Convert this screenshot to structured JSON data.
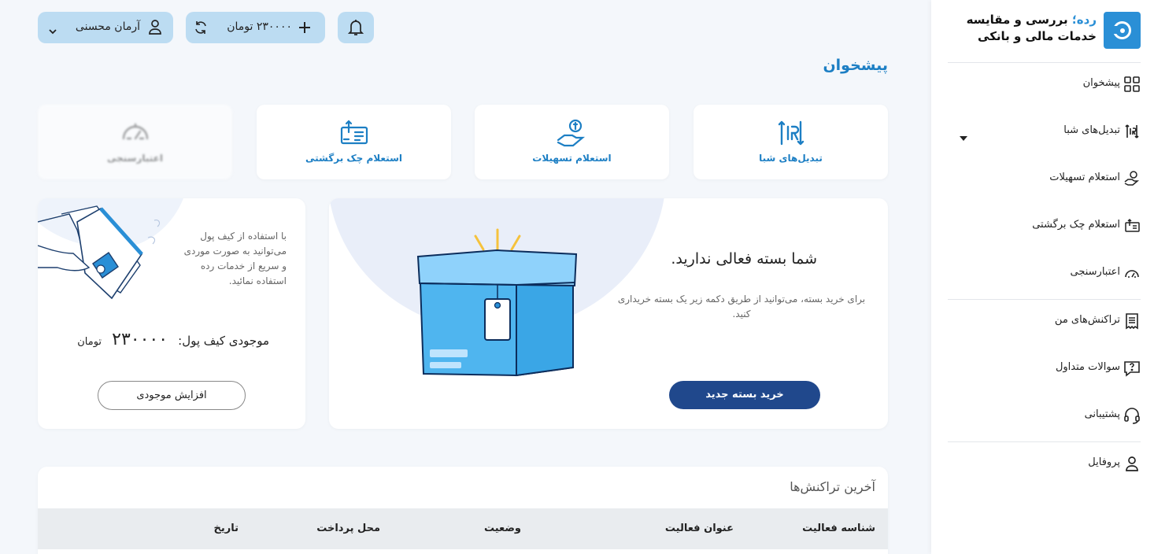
{
  "sidebar": {
    "brand": {
      "name": "رده؛",
      "title_rest": " بررسی و مقایسه",
      "subtitle": "خدمات مالی و بانکی"
    },
    "items": [
      {
        "label": "پیشخوان",
        "icon": "dashboard-grid-icon"
      },
      {
        "label": "تبدیل‌های شبا",
        "icon": "iban-convert-icon",
        "has_dropdown": true
      },
      {
        "label": "استعلام تسهیلات",
        "icon": "loan-hand-icon"
      },
      {
        "label": "استعلام چک برگشتی",
        "icon": "bounced-check-icon"
      },
      {
        "label": "اعتبارسنجی",
        "icon": "credit-gauge-icon"
      },
      {
        "label": "تراکنش‌های من",
        "icon": "receipt-icon"
      },
      {
        "label": "سوالات متداول",
        "icon": "faq-icon"
      },
      {
        "label": "پشتیبانی",
        "icon": "headset-icon"
      },
      {
        "label": "پروفایل",
        "icon": "user-icon"
      }
    ]
  },
  "topbar": {
    "user_name": "آرمان محسنی",
    "wallet_amount": "۲۳۰۰۰۰ تومان"
  },
  "page_title": "پیشخوان",
  "services": [
    {
      "label": "تبدیل‌های شبا",
      "icon": "iban-convert-icon",
      "enabled": true
    },
    {
      "label": "استعلام تسهیلات",
      "icon": "loan-hand-icon",
      "enabled": true
    },
    {
      "label": "استعلام چک برگشتی",
      "icon": "bounced-check-icon",
      "enabled": true
    },
    {
      "label": "اعتبارسنجی",
      "icon": "credit-gauge-icon",
      "enabled": false
    }
  ],
  "package": {
    "title": "شما بسته فعالی ندارید.",
    "description": "برای خرید بسته، می‌توانید از طریق دکمه زیر یک بسته خریداری کنید.",
    "button": "خرید بسته جدید"
  },
  "wallet": {
    "description": "با استفاده از کیف پول می‌توانید به صورت موردی و سریع از خدمات رده استفاده نمائید.",
    "balance_label": "موجودی کیف پول:",
    "balance_value": "۲۳۰۰۰۰",
    "balance_unit": "تومان",
    "button": "افزایش موجودی"
  },
  "transactions": {
    "title": "آخرین تراکنش‌ها",
    "columns": [
      "شناسه فعالیت",
      "عنوان فعالیت",
      "وضعیت",
      "محل پرداخت",
      "تاریخ"
    ]
  },
  "colors": {
    "accent": "#1d7fc4",
    "brand_blue": "#2a8fd6",
    "primary_button": "#20488c",
    "pill_bg": "#bcdcf2",
    "page_bg": "#f4f7fb"
  }
}
